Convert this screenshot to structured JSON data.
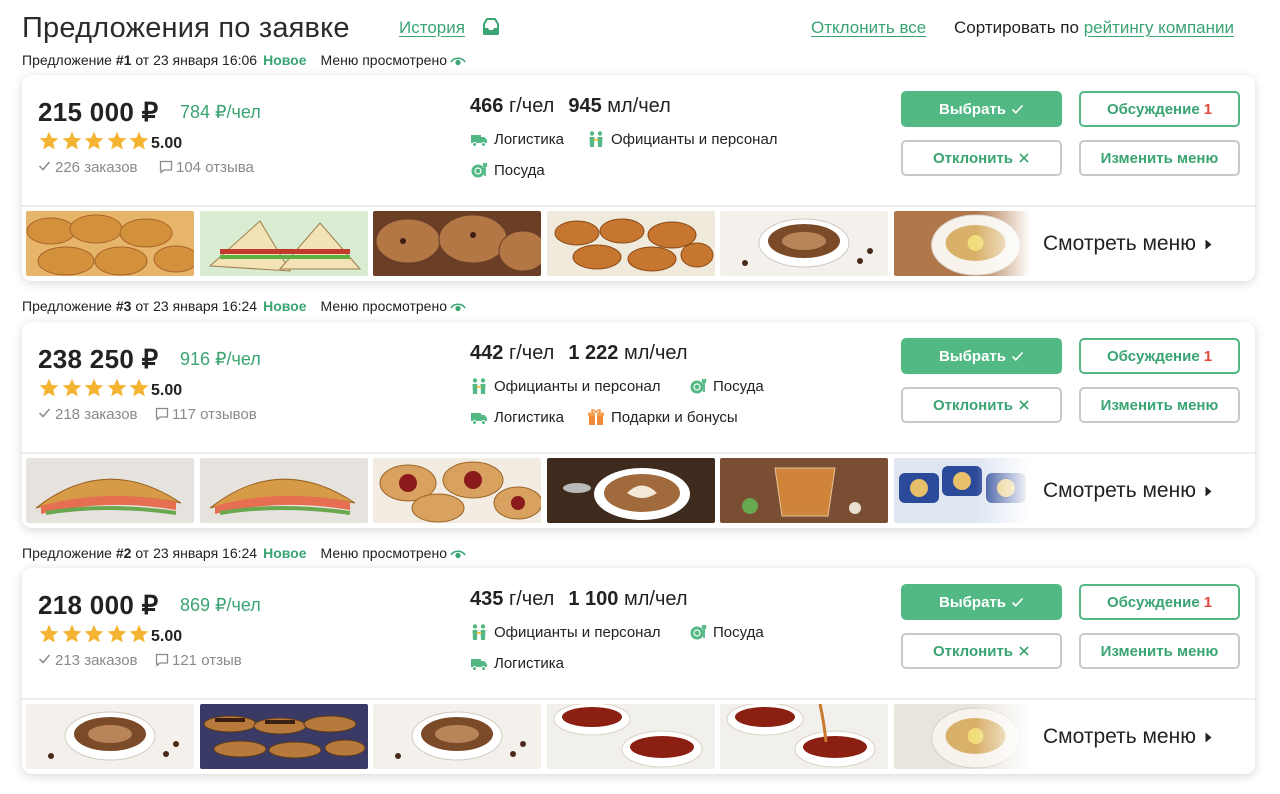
{
  "header": {
    "title": "Предложения по заявке",
    "history_label": "История",
    "reject_all_label": "Отклонить все",
    "sort_prefix": "Сортировать по",
    "sort_value": "рейтингу компании"
  },
  "colors": {
    "accent": "#3aa472",
    "button": "#52b884",
    "star": "#f4b431",
    "counter": "#e04a3c"
  },
  "offers": [
    {
      "meta": {
        "prefix": "Предложение",
        "number": "#1",
        "date": "от 23 января 16:06",
        "status": "Новое",
        "viewed": "Меню просмотрено"
      },
      "price": "215 000 ₽",
      "per_person": "784 ₽/чел",
      "rating": "5.00",
      "orders": "226 заказов",
      "reviews": "104 отзыва",
      "weight": "466",
      "weight_unit": "г/чел",
      "volume": "945",
      "volume_unit": "мл/чел",
      "features": [
        "Логистика",
        "Официанты и персонал",
        "Посуда"
      ],
      "buttons": {
        "choose": "Выбрать",
        "discuss": "Обсуждение",
        "discuss_count": "1",
        "reject": "Отклонить",
        "change": "Изменить меню"
      },
      "see_menu": "Смотреть меню",
      "photos": [
        "croissants",
        "club-sandwiches",
        "muffins",
        "baked-pies",
        "coffee-cup",
        "tea-cup"
      ]
    },
    {
      "meta": {
        "prefix": "Предложение",
        "number": "#3",
        "date": "от 23 января 16:24",
        "status": "Новое",
        "viewed": "Меню просмотрено"
      },
      "price": "238 250 ₽",
      "per_person": "916 ₽/чел",
      "rating": "5.00",
      "orders": "218 заказов",
      "reviews": "117 отзывов",
      "weight": "442",
      "weight_unit": "г/чел",
      "volume": "1 222",
      "volume_unit": "мл/чел",
      "features": [
        "Официанты и персонал",
        "Посуда",
        "Логистика",
        "Подарки и бонусы"
      ],
      "buttons": {
        "choose": "Выбрать",
        "discuss": "Обсуждение",
        "discuss_count": "1",
        "reject": "Отклонить",
        "change": "Изменить меню"
      },
      "see_menu": "Смотреть меню",
      "photos": [
        "croissant-sandwich",
        "chicken-croissant",
        "jam-pastries",
        "latte-art",
        "tea-glass",
        "packaged-snacks"
      ]
    },
    {
      "meta": {
        "prefix": "Предложение",
        "number": "#2",
        "date": "от 23 января 16:24",
        "status": "Новое",
        "viewed": "Меню просмотрено"
      },
      "price": "218 000 ₽",
      "per_person": "869 ₽/чел",
      "rating": "5.00",
      "orders": "213 заказов",
      "reviews": "121 отзыв",
      "weight": "435",
      "weight_unit": "г/чел",
      "volume": "1 100",
      "volume_unit": "мл/чел",
      "features": [
        "Официанты и персонал",
        "Посуда",
        "Логистика"
      ],
      "buttons": {
        "choose": "Выбрать",
        "discuss": "Обсуждение",
        "discuss_count": "1",
        "reject": "Отклонить",
        "change": "Изменить меню"
      },
      "see_menu": "Смотреть меню",
      "photos": [
        "cappuccino",
        "eclairs",
        "cappuccino",
        "tea-cups",
        "tea-pouring",
        "tea-cup-white"
      ]
    }
  ]
}
